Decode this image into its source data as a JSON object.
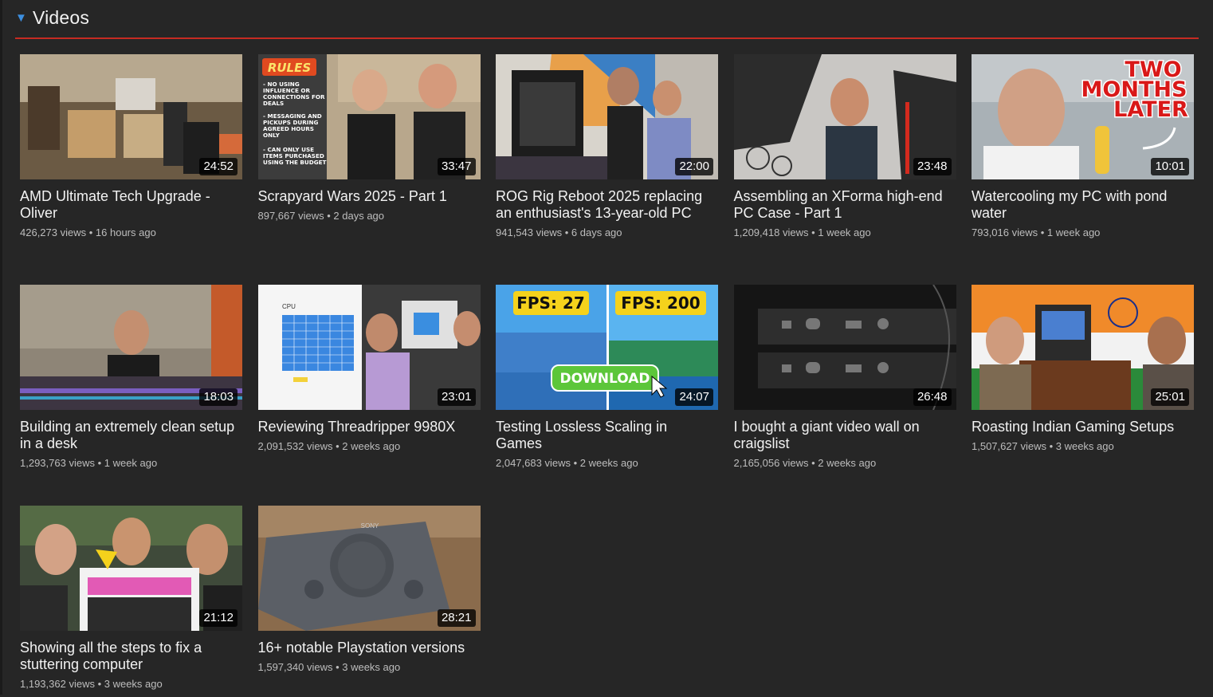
{
  "section": {
    "title": "Videos",
    "caret": "▼"
  },
  "colors": {
    "background": "#262626",
    "divider": "#c62b22",
    "caret": "#3d8fe0"
  },
  "videos": [
    {
      "title": "AMD Ultimate Tech Upgrade - Oliver",
      "views": "426,273 views",
      "age": "16 hours ago",
      "duration": "24:52"
    },
    {
      "title": "Scrapyard Wars 2025 - Part 1",
      "views": "897,667 views",
      "age": "2 days ago",
      "duration": "33:47",
      "overlay": {
        "header": "RULES",
        "rules": [
          "- NO USING",
          "INFLUENCE OR",
          "CONNECTIONS FOR",
          "DEALS",
          "- MESSAGING AND",
          "PICKUPS DURING",
          "AGREED HOURS",
          "ONLY",
          "- CAN ONLY USE",
          "ITEMS PURCHASED",
          "USING THE BUDGET"
        ]
      }
    },
    {
      "title": "ROG Rig Reboot 2025 replacing an enthusiast's 13-year-old PC",
      "views": "941,543 views",
      "age": "6 days ago",
      "duration": "22:00"
    },
    {
      "title": "Assembling an XForma high-end PC Case - Part 1",
      "views": "1,209,418 views",
      "age": "1 week ago",
      "duration": "23:48"
    },
    {
      "title": "Watercooling my PC with pond water",
      "views": "793,016 views",
      "age": "1 week ago",
      "duration": "10:01",
      "overlay": {
        "line1": "TWO",
        "line2": "MONTHS",
        "line3": "LATER"
      }
    },
    {
      "title": "Building an extremely clean setup in a desk",
      "views": "1,293,763 views",
      "age": "1 week ago",
      "duration": "18:03"
    },
    {
      "title": "Reviewing Threadripper 9980X",
      "views": "2,091,532 views",
      "age": "2 weeks ago",
      "duration": "23:01",
      "overlay": {
        "label": "CPU"
      }
    },
    {
      "title": "Testing Lossless Scaling in Games",
      "views": "2,047,683 views",
      "age": "2 weeks ago",
      "duration": "24:07",
      "overlay": {
        "left": "FPS: 27",
        "right": "FPS: 200",
        "button": "DOWNLOAD"
      }
    },
    {
      "title": "I bought a giant video wall on craigslist",
      "views": "2,165,056 views",
      "age": "2 weeks ago",
      "duration": "26:48"
    },
    {
      "title": "Roasting Indian Gaming Setups",
      "views": "1,507,627 views",
      "age": "3 weeks ago",
      "duration": "25:01"
    },
    {
      "title": "Showing all the steps to fix a stuttering computer",
      "views": "1,193,362 views",
      "age": "3 weeks ago",
      "duration": "21:12"
    },
    {
      "title": "16+ notable Playstation versions",
      "views": "1,597,340 views",
      "age": "3 weeks ago",
      "duration": "28:21",
      "overlay": {
        "brand": "SONY"
      }
    }
  ]
}
